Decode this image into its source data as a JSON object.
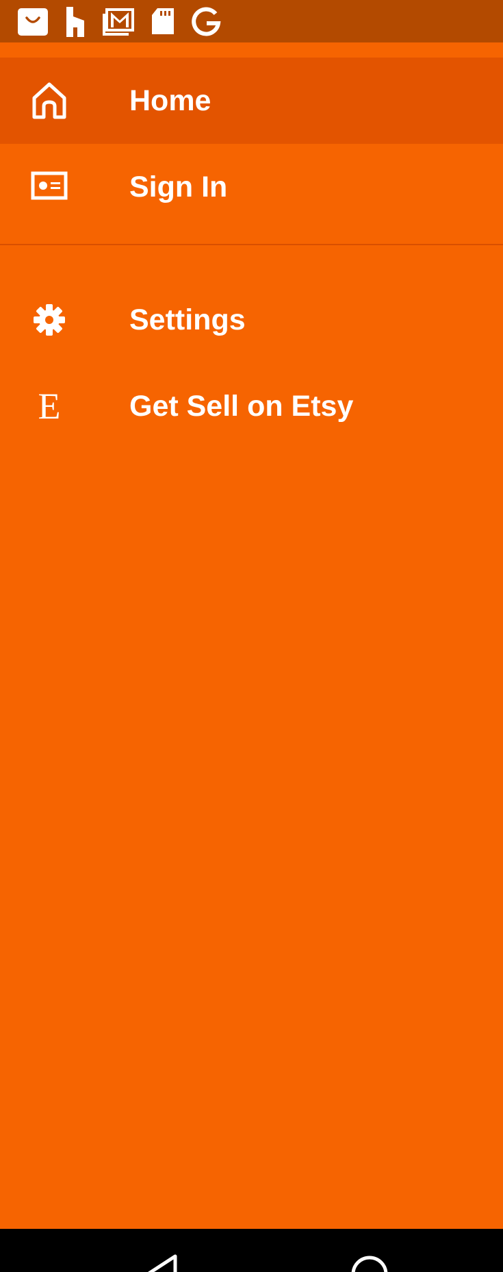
{
  "status_bar": {
    "icons": [
      "shopping-bag-icon",
      "houzz-icon",
      "gmail-icon",
      "sd-card-icon",
      "google-icon"
    ]
  },
  "drawer": {
    "items": [
      {
        "icon": "home-icon",
        "label": "Home",
        "active": true
      },
      {
        "icon": "id-card-icon",
        "label": "Sign In",
        "active": false
      },
      {
        "icon": "gear-icon",
        "label": "Settings",
        "active": false
      },
      {
        "icon": "etsy-e-icon",
        "icon_text": "E",
        "label": "Get Sell on Etsy",
        "active": false
      }
    ]
  },
  "nav_bar": {
    "buttons": [
      "back-icon",
      "home-circle-icon"
    ]
  },
  "colors": {
    "drawer_bg": "#F66401",
    "active_item_bg": "#E35400",
    "status_bar_bg": "#B34A00",
    "text": "#FFFFFF",
    "nav_bar_bg": "#000000"
  }
}
